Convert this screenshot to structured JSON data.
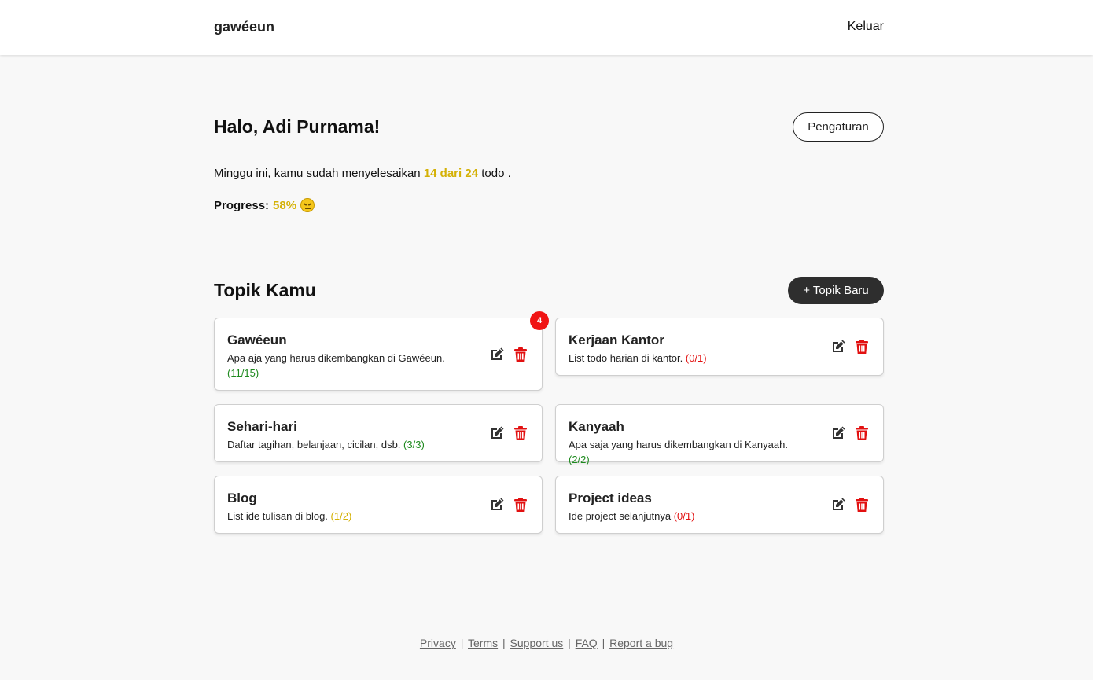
{
  "header": {
    "brand": "gawéeun",
    "logout": "Keluar"
  },
  "greeting": "Halo, Adi Purnama!",
  "settings_label": "Pengaturan",
  "summary": {
    "prefix": "Minggu ini, kamu sudah menyelesaikan",
    "highlight": "14 dari 24",
    "suffix": "todo ."
  },
  "progress": {
    "label": "Progress:",
    "value": "58%",
    "emoji": "persevering-face-emoji"
  },
  "topics": {
    "title": "Topik Kamu",
    "new_button": "+ Topik Baru",
    "items": [
      {
        "title": "Gawéeun",
        "desc": "Apa aja yang harus dikembangkan di Gawéeun.",
        "count": "(11/15)",
        "status": "green",
        "badge": "4"
      },
      {
        "title": "Kerjaan Kantor",
        "desc": "List todo harian di kantor.",
        "count": "(0/1)",
        "status": "red"
      },
      {
        "title": "Sehari-hari",
        "desc": "Daftar tagihan, belanjaan, cicilan, dsb.",
        "count": "(3/3)",
        "status": "green"
      },
      {
        "title": "Kanyaah",
        "desc": "Apa saja yang harus dikembangkan di Kanyaah.",
        "count": "(2/2)",
        "status": "green"
      },
      {
        "title": "Blog",
        "desc": "List ide tulisan di blog.",
        "count": "(1/2)",
        "status": "yellow"
      },
      {
        "title": "Project ideas",
        "desc": "Ide project selanjutnya",
        "count": "(0/1)",
        "status": "red"
      }
    ]
  },
  "footer": {
    "links": [
      "Privacy",
      "Terms",
      "Support us",
      "FAQ",
      "Report a bug"
    ],
    "separator": "|"
  },
  "colors": {
    "accent": "#d4b106",
    "green": "#1e8a1e",
    "red": "#e21010",
    "dark_button": "#2e2e2e"
  }
}
